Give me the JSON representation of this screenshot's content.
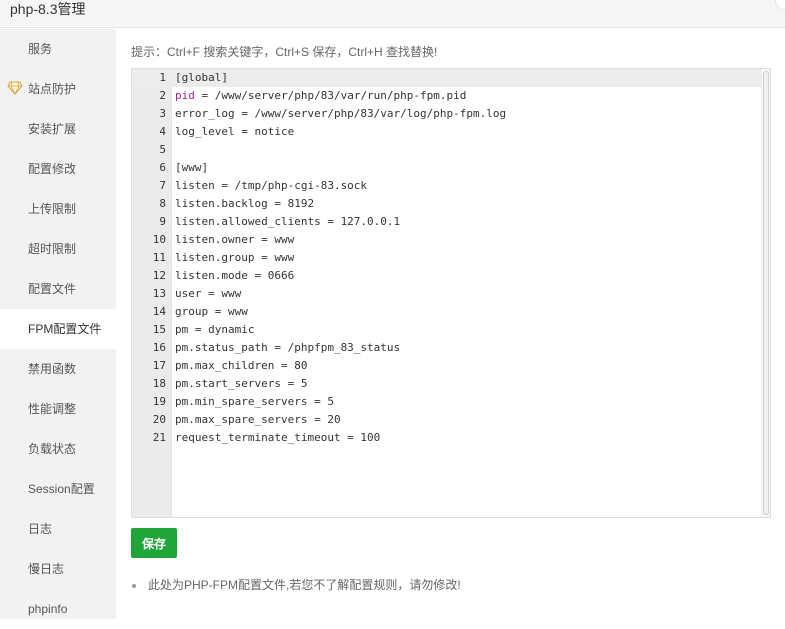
{
  "window": {
    "title": "php-8.3管理"
  },
  "sidebar": {
    "items": [
      {
        "label": "服务"
      },
      {
        "label": "站点防护",
        "icon": "diamond-icon"
      },
      {
        "label": "安装扩展"
      },
      {
        "label": "配置修改"
      },
      {
        "label": "上传限制"
      },
      {
        "label": "超时限制"
      },
      {
        "label": "配置文件"
      },
      {
        "label": "FPM配置文件",
        "active": true
      },
      {
        "label": "禁用函数"
      },
      {
        "label": "性能调整"
      },
      {
        "label": "负载状态"
      },
      {
        "label": "Session配置"
      },
      {
        "label": "日志"
      },
      {
        "label": "慢日志"
      },
      {
        "label": "phpinfo"
      }
    ]
  },
  "main": {
    "hint": "提示：Ctrl+F 搜索关键字，Ctrl+S 保存，Ctrl+H 查找替换!",
    "editor": {
      "lines": [
        {
          "num": "1",
          "key": "",
          "text": "[global]"
        },
        {
          "num": "2",
          "key": "pid",
          "text": " = /www/server/php/83/var/run/php-fpm.pid"
        },
        {
          "num": "3",
          "key": "",
          "text": "error_log = /www/server/php/83/var/log/php-fpm.log"
        },
        {
          "num": "4",
          "key": "",
          "text": "log_level = notice"
        },
        {
          "num": "5",
          "key": "",
          "text": ""
        },
        {
          "num": "6",
          "key": "",
          "text": "[www]"
        },
        {
          "num": "7",
          "key": "",
          "text": "listen = /tmp/php-cgi-83.sock"
        },
        {
          "num": "8",
          "key": "",
          "text": "listen.backlog = 8192"
        },
        {
          "num": "9",
          "key": "",
          "text": "listen.allowed_clients = 127.0.0.1"
        },
        {
          "num": "10",
          "key": "",
          "text": "listen.owner = www"
        },
        {
          "num": "11",
          "key": "",
          "text": "listen.group = www"
        },
        {
          "num": "12",
          "key": "",
          "text": "listen.mode = 0666"
        },
        {
          "num": "13",
          "key": "",
          "text": "user = www"
        },
        {
          "num": "14",
          "key": "",
          "text": "group = www"
        },
        {
          "num": "15",
          "key": "",
          "text": "pm = dynamic"
        },
        {
          "num": "16",
          "key": "",
          "text": "pm.status_path = /phpfpm_83_status"
        },
        {
          "num": "17",
          "key": "",
          "text": "pm.max_children = 80"
        },
        {
          "num": "18",
          "key": "",
          "text": "pm.start_servers = 5"
        },
        {
          "num": "19",
          "key": "",
          "text": "pm.min_spare_servers = 5"
        },
        {
          "num": "20",
          "key": "",
          "text": "pm.max_spare_servers = 20"
        },
        {
          "num": "21",
          "key": "",
          "text": "request_terminate_timeout = 100"
        }
      ]
    },
    "save_label": "保存",
    "note": "此处为PHP-FPM配置文件,若您不了解配置规则，请勿修改!"
  },
  "colors": {
    "accent": "#20a53a",
    "keyword": "#a0288c",
    "sidebar_bg": "#f2f2f2"
  }
}
